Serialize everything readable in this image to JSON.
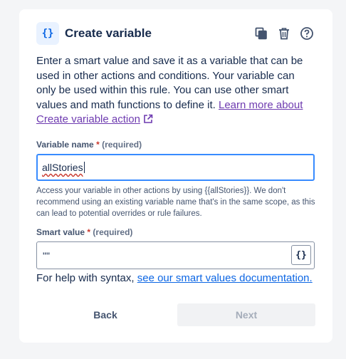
{
  "dialog": {
    "title": "Create variable",
    "icon_glyph": "{}",
    "actions": [
      "duplicate-icon",
      "trash-icon",
      "help-icon"
    ]
  },
  "description": {
    "text": "Enter a smart value and save it as a variable that can be used in other actions and conditions. Your variable can only be used within this rule. You can use other smart values and math functions to define it. ",
    "link_text": "Learn more about Create variable action"
  },
  "variable_name": {
    "label": "Variable name",
    "required_mark": "*",
    "required_text": "(required)",
    "value": "allStories",
    "help_text": "Access your variable in other actions by using {{allStories}}. We don't recommend using an existing variable name that's in the same scope, as this can lead to potential overrides or rule failures."
  },
  "smart_value": {
    "label": "Smart value",
    "required_mark": "*",
    "required_text": "(required)",
    "value": "\"\"",
    "insert_button_glyph": "{}"
  },
  "syntax_help": {
    "prefix": "For help with syntax, ",
    "link_text": "see our smart values documentation."
  },
  "footer": {
    "back_label": "Back",
    "next_label": "Next"
  },
  "colors": {
    "accent": "#0c66e4",
    "link_visited": "#6e3bb0",
    "required": "#c9372c",
    "focus_border": "#388bff"
  }
}
